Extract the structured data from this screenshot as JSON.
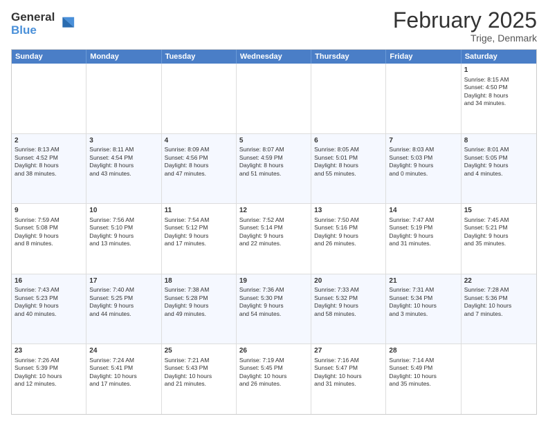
{
  "logo": {
    "general": "General",
    "blue": "Blue"
  },
  "title": "February 2025",
  "subtitle": "Trige, Denmark",
  "days": [
    "Sunday",
    "Monday",
    "Tuesday",
    "Wednesday",
    "Thursday",
    "Friday",
    "Saturday"
  ],
  "weeks": [
    [
      {
        "day": "",
        "content": ""
      },
      {
        "day": "",
        "content": ""
      },
      {
        "day": "",
        "content": ""
      },
      {
        "day": "",
        "content": ""
      },
      {
        "day": "",
        "content": ""
      },
      {
        "day": "",
        "content": ""
      },
      {
        "day": "1",
        "content": "Sunrise: 8:15 AM\nSunset: 4:50 PM\nDaylight: 8 hours\nand 34 minutes."
      }
    ],
    [
      {
        "day": "2",
        "content": "Sunrise: 8:13 AM\nSunset: 4:52 PM\nDaylight: 8 hours\nand 38 minutes."
      },
      {
        "day": "3",
        "content": "Sunrise: 8:11 AM\nSunset: 4:54 PM\nDaylight: 8 hours\nand 43 minutes."
      },
      {
        "day": "4",
        "content": "Sunrise: 8:09 AM\nSunset: 4:56 PM\nDaylight: 8 hours\nand 47 minutes."
      },
      {
        "day": "5",
        "content": "Sunrise: 8:07 AM\nSunset: 4:59 PM\nDaylight: 8 hours\nand 51 minutes."
      },
      {
        "day": "6",
        "content": "Sunrise: 8:05 AM\nSunset: 5:01 PM\nDaylight: 8 hours\nand 55 minutes."
      },
      {
        "day": "7",
        "content": "Sunrise: 8:03 AM\nSunset: 5:03 PM\nDaylight: 9 hours\nand 0 minutes."
      },
      {
        "day": "8",
        "content": "Sunrise: 8:01 AM\nSunset: 5:05 PM\nDaylight: 9 hours\nand 4 minutes."
      }
    ],
    [
      {
        "day": "9",
        "content": "Sunrise: 7:59 AM\nSunset: 5:08 PM\nDaylight: 9 hours\nand 8 minutes."
      },
      {
        "day": "10",
        "content": "Sunrise: 7:56 AM\nSunset: 5:10 PM\nDaylight: 9 hours\nand 13 minutes."
      },
      {
        "day": "11",
        "content": "Sunrise: 7:54 AM\nSunset: 5:12 PM\nDaylight: 9 hours\nand 17 minutes."
      },
      {
        "day": "12",
        "content": "Sunrise: 7:52 AM\nSunset: 5:14 PM\nDaylight: 9 hours\nand 22 minutes."
      },
      {
        "day": "13",
        "content": "Sunrise: 7:50 AM\nSunset: 5:16 PM\nDaylight: 9 hours\nand 26 minutes."
      },
      {
        "day": "14",
        "content": "Sunrise: 7:47 AM\nSunset: 5:19 PM\nDaylight: 9 hours\nand 31 minutes."
      },
      {
        "day": "15",
        "content": "Sunrise: 7:45 AM\nSunset: 5:21 PM\nDaylight: 9 hours\nand 35 minutes."
      }
    ],
    [
      {
        "day": "16",
        "content": "Sunrise: 7:43 AM\nSunset: 5:23 PM\nDaylight: 9 hours\nand 40 minutes."
      },
      {
        "day": "17",
        "content": "Sunrise: 7:40 AM\nSunset: 5:25 PM\nDaylight: 9 hours\nand 44 minutes."
      },
      {
        "day": "18",
        "content": "Sunrise: 7:38 AM\nSunset: 5:28 PM\nDaylight: 9 hours\nand 49 minutes."
      },
      {
        "day": "19",
        "content": "Sunrise: 7:36 AM\nSunset: 5:30 PM\nDaylight: 9 hours\nand 54 minutes."
      },
      {
        "day": "20",
        "content": "Sunrise: 7:33 AM\nSunset: 5:32 PM\nDaylight: 9 hours\nand 58 minutes."
      },
      {
        "day": "21",
        "content": "Sunrise: 7:31 AM\nSunset: 5:34 PM\nDaylight: 10 hours\nand 3 minutes."
      },
      {
        "day": "22",
        "content": "Sunrise: 7:28 AM\nSunset: 5:36 PM\nDaylight: 10 hours\nand 7 minutes."
      }
    ],
    [
      {
        "day": "23",
        "content": "Sunrise: 7:26 AM\nSunset: 5:39 PM\nDaylight: 10 hours\nand 12 minutes."
      },
      {
        "day": "24",
        "content": "Sunrise: 7:24 AM\nSunset: 5:41 PM\nDaylight: 10 hours\nand 17 minutes."
      },
      {
        "day": "25",
        "content": "Sunrise: 7:21 AM\nSunset: 5:43 PM\nDaylight: 10 hours\nand 21 minutes."
      },
      {
        "day": "26",
        "content": "Sunrise: 7:19 AM\nSunset: 5:45 PM\nDaylight: 10 hours\nand 26 minutes."
      },
      {
        "day": "27",
        "content": "Sunrise: 7:16 AM\nSunset: 5:47 PM\nDaylight: 10 hours\nand 31 minutes."
      },
      {
        "day": "28",
        "content": "Sunrise: 7:14 AM\nSunset: 5:49 PM\nDaylight: 10 hours\nand 35 minutes."
      },
      {
        "day": "",
        "content": ""
      }
    ]
  ]
}
